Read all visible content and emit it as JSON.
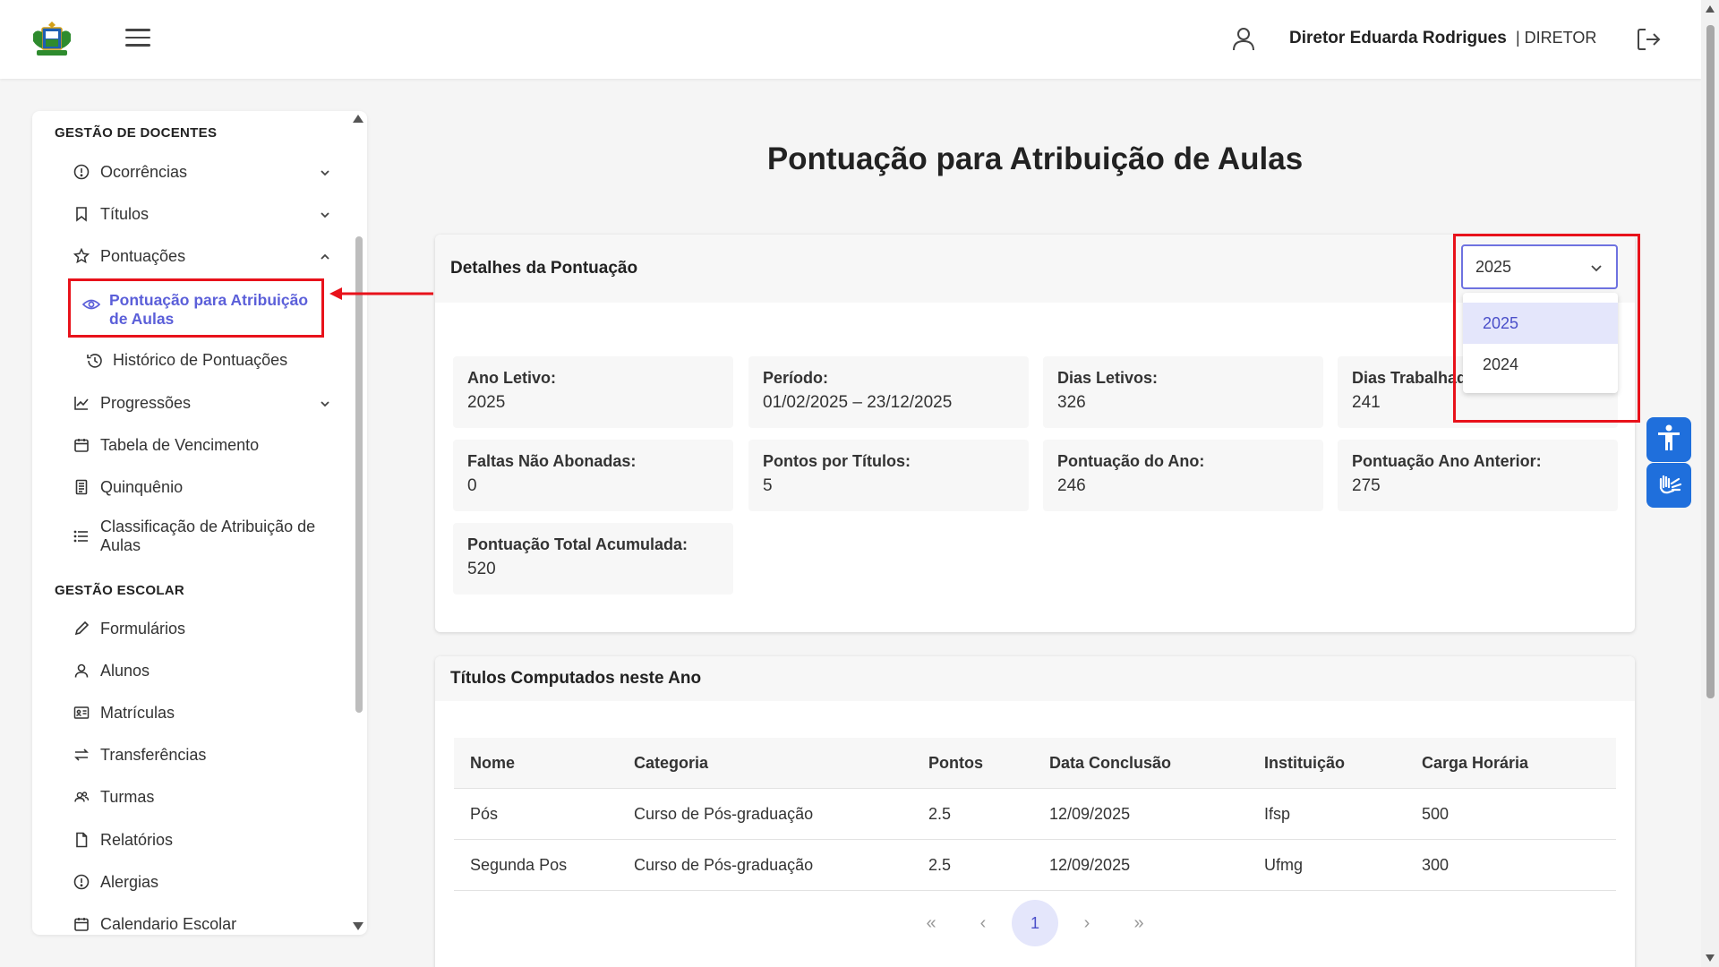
{
  "header": {
    "user_name": "Diretor Eduarda Rodrigues",
    "user_role": "| DIRETOR"
  },
  "sidebar": {
    "section_docentes": "GESTÃO DE DOCENTES",
    "ocorrencias": "Ocorrências",
    "titulos": "Títulos",
    "pontuacoes": "Pontuações",
    "pontuacao_atribuicao": "Pontuação para Atribuição de Aulas",
    "historico": "Histórico de Pontuações",
    "progressoes": "Progressões",
    "tabela_vencimento": "Tabela de Vencimento",
    "quinquenio": "Quinquênio",
    "classificacao": "Classificação de Atribuição de Aulas",
    "section_escolar": "GESTÃO ESCOLAR",
    "formularios": "Formulários",
    "alunos": "Alunos",
    "matriculas": "Matrículas",
    "transferencias": "Transferências",
    "turmas": "Turmas",
    "relatorios": "Relatórios",
    "alergias": "Alergias",
    "calendario": "Calendario Escolar"
  },
  "page": {
    "title": "Pontuação para Atribuição de Aulas"
  },
  "details": {
    "header": "Detalhes da Pontuação",
    "year_select": {
      "value": "2025",
      "options": [
        "2025",
        "2024"
      ]
    },
    "tiles": [
      {
        "label": "Ano Letivo:",
        "value": "2025"
      },
      {
        "label": "Período:",
        "value": "01/02/2025 – 23/12/2025"
      },
      {
        "label": "Dias Letivos:",
        "value": "326"
      },
      {
        "label": "Dias Trabalhados:",
        "value": "241"
      },
      {
        "label": "Faltas Não Abonadas:",
        "value": "0"
      },
      {
        "label": "Pontos por Títulos:",
        "value": "5"
      },
      {
        "label": "Pontuação do Ano:",
        "value": "246"
      },
      {
        "label": "Pontuação Ano Anterior:",
        "value": "275"
      },
      {
        "label": "Pontuação Total Acumulada:",
        "value": "520"
      }
    ]
  },
  "titulos": {
    "header": "Títulos Computados neste Ano",
    "columns": [
      "Nome",
      "Categoria",
      "Pontos",
      "Data Conclusão",
      "Instituição",
      "Carga Horária"
    ],
    "rows": [
      [
        "Pós",
        "Curso de Pós-graduação",
        "2.5",
        "12/09/2025",
        "Ifsp",
        "500"
      ],
      [
        "Segunda Pos",
        "Curso de Pós-graduação",
        "2.5",
        "12/09/2025",
        "Ufmg",
        "300"
      ]
    ],
    "pagination": {
      "first": "«",
      "prev": "‹",
      "current": "1",
      "next": "›",
      "last": "»"
    }
  },
  "colors": {
    "accent": "#5b5fd9",
    "annotation": "#e8121b",
    "accessibility": "#1f6fdc"
  }
}
